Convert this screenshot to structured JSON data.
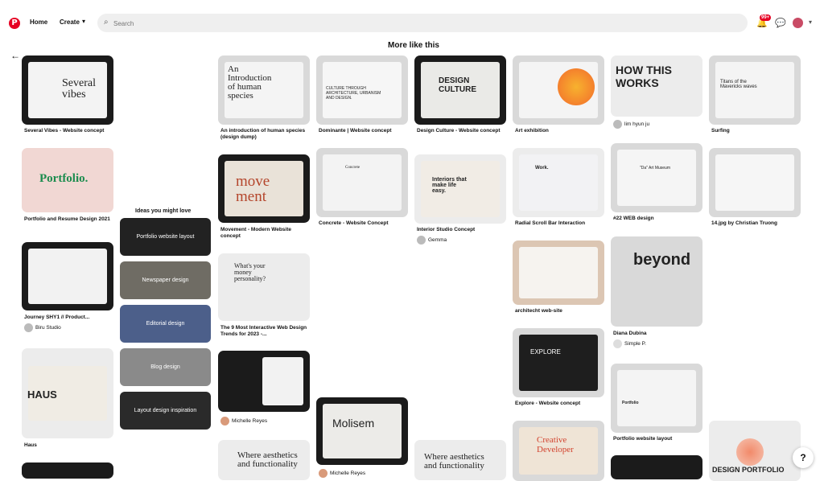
{
  "header": {
    "logo_icon": "pinterest-logo-icon",
    "home": "Home",
    "create": "Create",
    "search_placeholder": "Search",
    "notification_count": "99+"
  },
  "section_title": "More like this",
  "ideas": {
    "title": "Ideas you might love",
    "items": [
      "Portfolio website layout",
      "Newspaper design",
      "Editorial design",
      "Blog design",
      "Layout design inspiration"
    ]
  },
  "pins": [
    {
      "title": "Several Vibes - Website concept",
      "mock": "Several vibes"
    },
    {
      "title": "Portfolio and Resume Design 2021",
      "mock": "Portfolio."
    },
    {
      "title": "Journey SHY1 // Product...",
      "author": "Biru Studio"
    },
    {
      "title": "Haus",
      "mock": "HAUS"
    },
    {
      "title": "An introduction of human species (design dump)",
      "mock": "An Introduction of human species"
    },
    {
      "title": "Movement - Modern Website concept",
      "mock": "move ment"
    },
    {
      "title": "The 9 Most Interactive Web Design Trends for 2023 -...",
      "mock": "What's your money personality?"
    },
    {
      "title": "",
      "author": "Michelle Reyes"
    },
    {
      "title": "Dominante | Website concept",
      "mock": "CULTURE THROUGH ARCHITECTURE, URBANISM AND DESIGN."
    },
    {
      "title": "Concrete - Website Concept",
      "mock": "Concrete"
    },
    {
      "title": "",
      "author": "Michelle Reyes",
      "mock": "Molisem"
    },
    {
      "title": "Design Culture - Website concept",
      "mock": "DESIGN CULTURE"
    },
    {
      "title": "Interior Studio Concept",
      "author": "Gemma",
      "mock": "Interiors that make life easy."
    },
    {
      "title": "",
      "mock": "Where aesthetics and functionality"
    },
    {
      "title": "Art exhibition"
    },
    {
      "title": "Radial Scroll Bar Interaction",
      "mock": "Work."
    },
    {
      "title": "architecht web-site"
    },
    {
      "title": "Explore - Website concept",
      "mock": "EXPLORE"
    },
    {
      "title": "",
      "mock": "Creative Developer"
    },
    {
      "title": "",
      "author": "lim hyun ju",
      "mock": "HOW THIS WORKS"
    },
    {
      "title": "#22 WEB design",
      "mock": "\"Da\" Art Museum"
    },
    {
      "title": "Diana Dubina",
      "author": "Simple P.",
      "mock": "beyond"
    },
    {
      "title": "Portfolio website layout",
      "mock": "Portfolio"
    },
    {
      "title": "Surfing",
      "mock": "Titans of the Mavericks waves"
    },
    {
      "title": "14.jpg by Christian Truong"
    },
    {
      "title": "",
      "mock": "DESIGN PORTFOLIO"
    }
  ]
}
